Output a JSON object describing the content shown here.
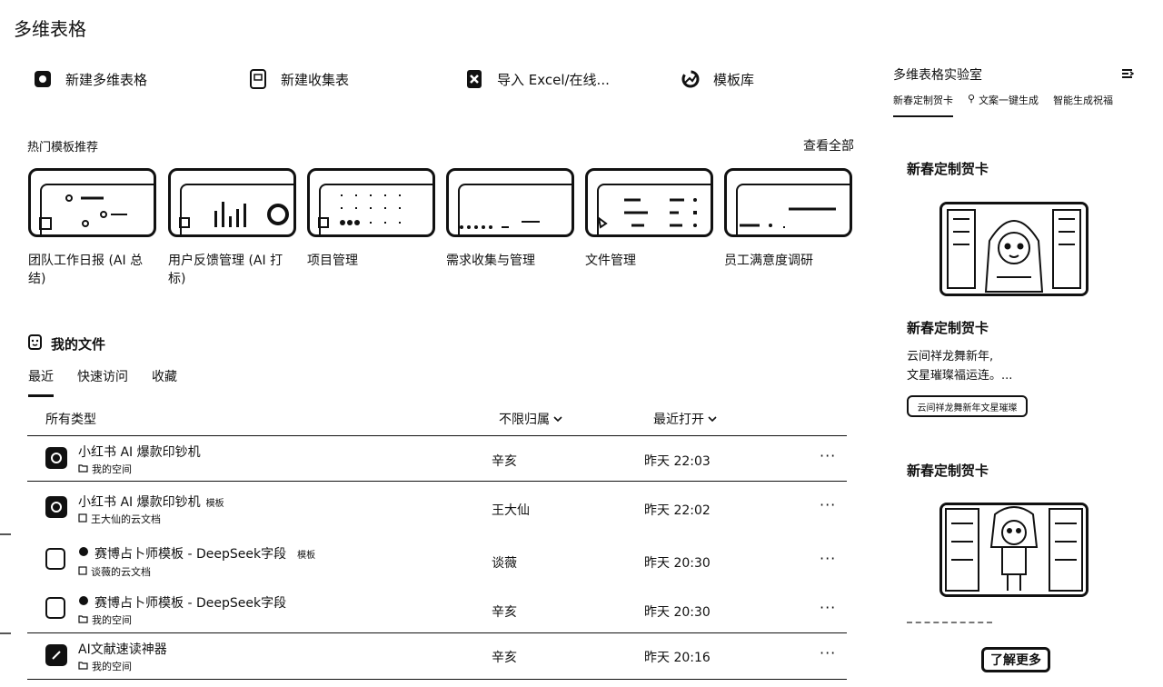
{
  "app": {
    "title": "多维表格"
  },
  "actions": [
    {
      "label": "新建多维表格",
      "icon": "table-icon"
    },
    {
      "label": "新建收集表",
      "icon": "form-icon"
    },
    {
      "label": "导入 Excel/在线...",
      "icon": "import-icon"
    },
    {
      "label": "模板库",
      "icon": "template-icon"
    }
  ],
  "templates": {
    "section_label": "热门模板推荐",
    "view_all": "查看全部",
    "items": [
      {
        "name": "团队工作日报 (AI 总结)"
      },
      {
        "name": "用户反馈管理 (AI 打标)"
      },
      {
        "name": "项目管理"
      },
      {
        "name": "需求收集与管理"
      },
      {
        "name": "文件管理"
      },
      {
        "name": "员工满意度调研"
      }
    ]
  },
  "files": {
    "section_label": "我的文件",
    "tabs": [
      "最近",
      "快速访问",
      "收藏"
    ],
    "active_tab": "最近",
    "filter_type": "所有类型",
    "filter_owner": "不限归属",
    "filter_sort": "最近打开",
    "rows": [
      {
        "name": "小红书 AI 爆款印钞机",
        "badge": "",
        "location": "我的空间",
        "owner": "辛亥",
        "time": "昨天 22:03"
      },
      {
        "name": "小红书 AI 爆款印钞机",
        "badge": "模板",
        "location": "王大仙的云文档",
        "owner": "王大仙",
        "time": "昨天 22:02"
      },
      {
        "name": "赛博占卜师模板 - DeepSeek字段",
        "badge": "模板",
        "location": "谈薇的云文档",
        "owner": "谈薇",
        "time": "昨天 20:30"
      },
      {
        "name": "赛博占卜师模板 - DeepSeek字段",
        "badge": "",
        "location": "我的空间",
        "owner": "辛亥",
        "time": "昨天 20:30"
      },
      {
        "name": "AI文献速读神器",
        "badge": "",
        "location": "我的空间",
        "owner": "辛亥",
        "time": "昨天 20:16"
      }
    ]
  },
  "sidebar": {
    "title": "多维表格实验室",
    "tabs": [
      "新春定制贺卡",
      "文案一键生成",
      "智能生成祝福"
    ],
    "card1_title": "新春定制贺卡",
    "card1_subtitle": "新春定制贺卡",
    "card1_desc_line1": "云间祥龙舞新年,",
    "card1_desc_line2": "文星璀璨福运连。...",
    "card1_button": "云间祥龙舞新年文星璀璨",
    "card2_title": "新春定制贺卡",
    "more_button": "了解更多"
  }
}
